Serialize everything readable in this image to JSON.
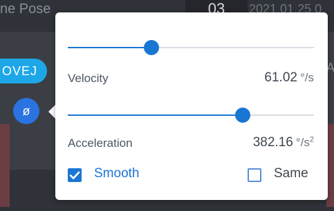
{
  "background": {
    "pose_text": "ne Pose",
    "number": "03",
    "date": "2021.01.25 0",
    "movej_label": "OVEJ",
    "circle_button_glyph": "ø",
    "edge_letter": "A"
  },
  "popover": {
    "velocity": {
      "label": "Velocity",
      "value": "61.02",
      "unit": "°/s",
      "slider_fraction": 0.34
    },
    "acceleration": {
      "label": "Acceleration",
      "value": "382.16",
      "unit": "°/s",
      "unit_exponent": "2",
      "slider_fraction": 0.71
    },
    "smooth": {
      "label": "Smooth",
      "checked": true
    },
    "same": {
      "label": "Same",
      "checked": false
    }
  },
  "colors": {
    "accent": "#1976d2",
    "button_cyan": "#1ea7e8",
    "button_blue": "#2a73e0"
  }
}
